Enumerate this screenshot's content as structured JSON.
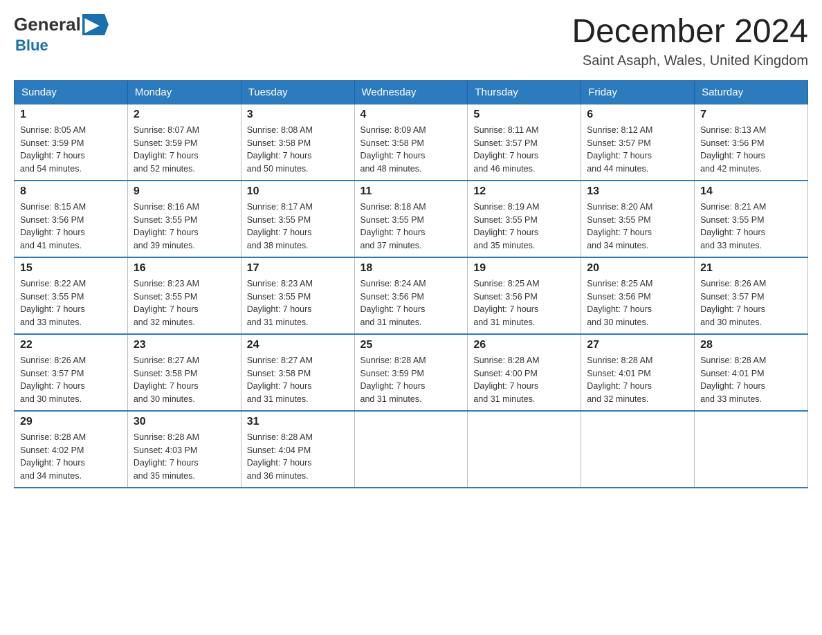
{
  "logo": {
    "general": "General",
    "arrow": "▶",
    "blue": "Blue"
  },
  "header": {
    "title": "December 2024",
    "subtitle": "Saint Asaph, Wales, United Kingdom"
  },
  "weekdays": [
    "Sunday",
    "Monday",
    "Tuesday",
    "Wednesday",
    "Thursday",
    "Friday",
    "Saturday"
  ],
  "weeks": [
    [
      {
        "day": "1",
        "sunrise": "8:05 AM",
        "sunset": "3:59 PM",
        "daylight": "7 hours and 54 minutes."
      },
      {
        "day": "2",
        "sunrise": "8:07 AM",
        "sunset": "3:59 PM",
        "daylight": "7 hours and 52 minutes."
      },
      {
        "day": "3",
        "sunrise": "8:08 AM",
        "sunset": "3:58 PM",
        "daylight": "7 hours and 50 minutes."
      },
      {
        "day": "4",
        "sunrise": "8:09 AM",
        "sunset": "3:58 PM",
        "daylight": "7 hours and 48 minutes."
      },
      {
        "day": "5",
        "sunrise": "8:11 AM",
        "sunset": "3:57 PM",
        "daylight": "7 hours and 46 minutes."
      },
      {
        "day": "6",
        "sunrise": "8:12 AM",
        "sunset": "3:57 PM",
        "daylight": "7 hours and 44 minutes."
      },
      {
        "day": "7",
        "sunrise": "8:13 AM",
        "sunset": "3:56 PM",
        "daylight": "7 hours and 42 minutes."
      }
    ],
    [
      {
        "day": "8",
        "sunrise": "8:15 AM",
        "sunset": "3:56 PM",
        "daylight": "7 hours and 41 minutes."
      },
      {
        "day": "9",
        "sunrise": "8:16 AM",
        "sunset": "3:55 PM",
        "daylight": "7 hours and 39 minutes."
      },
      {
        "day": "10",
        "sunrise": "8:17 AM",
        "sunset": "3:55 PM",
        "daylight": "7 hours and 38 minutes."
      },
      {
        "day": "11",
        "sunrise": "8:18 AM",
        "sunset": "3:55 PM",
        "daylight": "7 hours and 37 minutes."
      },
      {
        "day": "12",
        "sunrise": "8:19 AM",
        "sunset": "3:55 PM",
        "daylight": "7 hours and 35 minutes."
      },
      {
        "day": "13",
        "sunrise": "8:20 AM",
        "sunset": "3:55 PM",
        "daylight": "7 hours and 34 minutes."
      },
      {
        "day": "14",
        "sunrise": "8:21 AM",
        "sunset": "3:55 PM",
        "daylight": "7 hours and 33 minutes."
      }
    ],
    [
      {
        "day": "15",
        "sunrise": "8:22 AM",
        "sunset": "3:55 PM",
        "daylight": "7 hours and 33 minutes."
      },
      {
        "day": "16",
        "sunrise": "8:23 AM",
        "sunset": "3:55 PM",
        "daylight": "7 hours and 32 minutes."
      },
      {
        "day": "17",
        "sunrise": "8:23 AM",
        "sunset": "3:55 PM",
        "daylight": "7 hours and 31 minutes."
      },
      {
        "day": "18",
        "sunrise": "8:24 AM",
        "sunset": "3:56 PM",
        "daylight": "7 hours and 31 minutes."
      },
      {
        "day": "19",
        "sunrise": "8:25 AM",
        "sunset": "3:56 PM",
        "daylight": "7 hours and 31 minutes."
      },
      {
        "day": "20",
        "sunrise": "8:25 AM",
        "sunset": "3:56 PM",
        "daylight": "7 hours and 30 minutes."
      },
      {
        "day": "21",
        "sunrise": "8:26 AM",
        "sunset": "3:57 PM",
        "daylight": "7 hours and 30 minutes."
      }
    ],
    [
      {
        "day": "22",
        "sunrise": "8:26 AM",
        "sunset": "3:57 PM",
        "daylight": "7 hours and 30 minutes."
      },
      {
        "day": "23",
        "sunrise": "8:27 AM",
        "sunset": "3:58 PM",
        "daylight": "7 hours and 30 minutes."
      },
      {
        "day": "24",
        "sunrise": "8:27 AM",
        "sunset": "3:58 PM",
        "daylight": "7 hours and 31 minutes."
      },
      {
        "day": "25",
        "sunrise": "8:28 AM",
        "sunset": "3:59 PM",
        "daylight": "7 hours and 31 minutes."
      },
      {
        "day": "26",
        "sunrise": "8:28 AM",
        "sunset": "4:00 PM",
        "daylight": "7 hours and 31 minutes."
      },
      {
        "day": "27",
        "sunrise": "8:28 AM",
        "sunset": "4:01 PM",
        "daylight": "7 hours and 32 minutes."
      },
      {
        "day": "28",
        "sunrise": "8:28 AM",
        "sunset": "4:01 PM",
        "daylight": "7 hours and 33 minutes."
      }
    ],
    [
      {
        "day": "29",
        "sunrise": "8:28 AM",
        "sunset": "4:02 PM",
        "daylight": "7 hours and 34 minutes."
      },
      {
        "day": "30",
        "sunrise": "8:28 AM",
        "sunset": "4:03 PM",
        "daylight": "7 hours and 35 minutes."
      },
      {
        "day": "31",
        "sunrise": "8:28 AM",
        "sunset": "4:04 PM",
        "daylight": "7 hours and 36 minutes."
      },
      null,
      null,
      null,
      null
    ]
  ],
  "labels": {
    "sunrise": "Sunrise:",
    "sunset": "Sunset:",
    "daylight": "Daylight:"
  }
}
